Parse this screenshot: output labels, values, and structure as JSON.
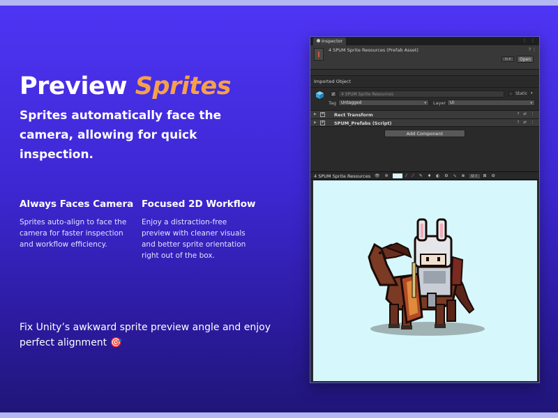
{
  "hero": {
    "title_plain": "Preview ",
    "title_accent": "Sprites",
    "subtitle": "Sprites automatically face the camera, allowing for quick inspection."
  },
  "features": [
    {
      "title": "Always Faces Camera",
      "body": "Sprites auto-align to face the camera for faster inspection and workflow efficiency."
    },
    {
      "title": "Focused 2D Workflow",
      "body": "Enjoy a distraction-free preview with cleaner visuals and better sprite orientation right out of the box."
    }
  ],
  "footer_text": "Fix Unity’s awkward sprite preview angle and enjoy perfect alignment 🎯",
  "unity": {
    "tab_label": "Inspector",
    "tab_icons": "⋮ ⋮",
    "asset_title": "4 SPUM Sprite Resources (Prefab Asset)",
    "header_icons": "? ⋮",
    "open_label": "Open",
    "dropdown_label": "⇆ ▾",
    "imported_object_label": "Imported Object",
    "object_name": "4 SPUM Sprite Resources",
    "static_label": "Static",
    "tag_label": "Tag",
    "tag_value": "Untagged",
    "layer_label": "Layer",
    "layer_value": "UI",
    "components": [
      {
        "name": "Rect Transform",
        "icons": "? ⇄ ⋮"
      },
      {
        "name": "SPUM_Prefabs (Script)",
        "icons": "? ⇄ ⋮"
      }
    ],
    "add_component_label": "Add Component",
    "preview_title": "4 SPUM Sprite Resources",
    "preview_tools_left": "👁 ✲",
    "preview_tools_right": "⁄ ⟋ ✎ ♦ ◐ ⚙ ∿ ⊗",
    "preview_ui_label": "UI",
    "preview_tools_end": "⊠ ⚙"
  },
  "colors": {
    "accent": "#f7a04b",
    "viewport_bg": "#d6f7fb",
    "page_bg": "#4f35f5"
  }
}
